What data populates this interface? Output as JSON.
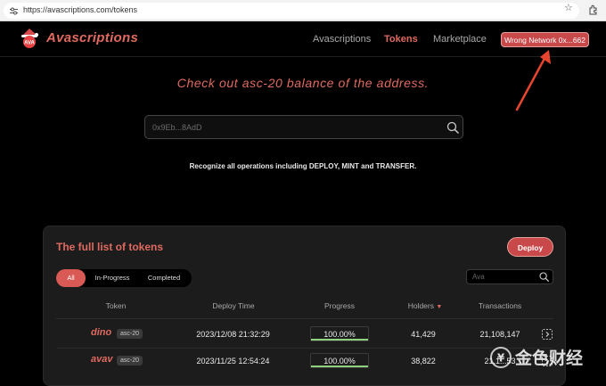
{
  "browser": {
    "url": "https://avascriptions.com/tokens"
  },
  "header": {
    "brand": "Avascriptions",
    "nav": [
      {
        "label": "Avascriptions",
        "active": false
      },
      {
        "label": "Tokens",
        "active": true
      },
      {
        "label": "Marketplace",
        "active": false
      }
    ],
    "network_button": "Wrong Network 0x...662"
  },
  "hero": {
    "headline": "Check out asc-20 balance of the address.",
    "search_placeholder": "0x9Eb...8AdD",
    "recognize_text": "Recognize all operations including DEPLOY, MINT and TRANSFER."
  },
  "panel": {
    "title": "The full list of tokens",
    "deploy_label": "Deploy",
    "tabs": [
      {
        "label": "All",
        "active": true
      },
      {
        "label": "In-Progress",
        "active": false
      },
      {
        "label": "Completed",
        "active": false
      }
    ],
    "search_placeholder": "Ava",
    "columns": [
      "Token",
      "Deploy Time",
      "Progress",
      "Holders",
      "Transactions"
    ],
    "rows": [
      {
        "token": "dino",
        "badge": "asc-20",
        "deploy_time": "2023/12/08 21:32:29",
        "progress": "100.00%",
        "progress_value": 1.0,
        "holders": "41,429",
        "transactions": "21,108,147"
      },
      {
        "token": "avav",
        "badge": "asc-20",
        "deploy_time": "2023/11/25 12:54:24",
        "progress": "100.00%",
        "progress_value": 1.0,
        "holders": "38,822",
        "transactions": "21,1...53"
      }
    ]
  },
  "watermark": {
    "text": "金色财经"
  },
  "colors": {
    "accent": "#e06a5f",
    "button_red": "#c9484a",
    "progress_green": "#8fd07e",
    "panel_bg": "#1c1c1d"
  }
}
